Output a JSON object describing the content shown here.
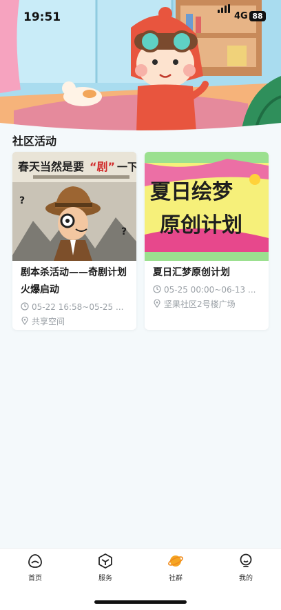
{
  "status_bar": {
    "time": "19:51",
    "network": "4G",
    "battery": "88"
  },
  "section": {
    "title": "社区活动"
  },
  "activities": [
    {
      "poster_headline": "春天当然是要",
      "poster_highlight": "“剧”",
      "poster_tail": "一下",
      "title": "剧本杀活动——奇剧计划火爆启动",
      "time": "05-22 16:58~05-25 ...",
      "location": "共享空间"
    },
    {
      "poster_line1": "夏日绘梦",
      "poster_line2": "原创计划",
      "title": "夏日汇梦原创计划",
      "time": "05-25 00:00~06-13 ...",
      "location": "坚果社区2号楼广场"
    }
  ],
  "tabs": [
    {
      "label": "首页",
      "icon": "home-icon",
      "active": false
    },
    {
      "label": "服务",
      "icon": "service-box-icon",
      "active": false
    },
    {
      "label": "社群",
      "icon": "planet-icon",
      "active": true
    },
    {
      "label": "我的",
      "icon": "profile-icon",
      "active": false
    }
  ],
  "colors": {
    "accent": "#f5a623",
    "page_bg": "#f4f9fb",
    "meta_text": "#9aa0a6"
  }
}
